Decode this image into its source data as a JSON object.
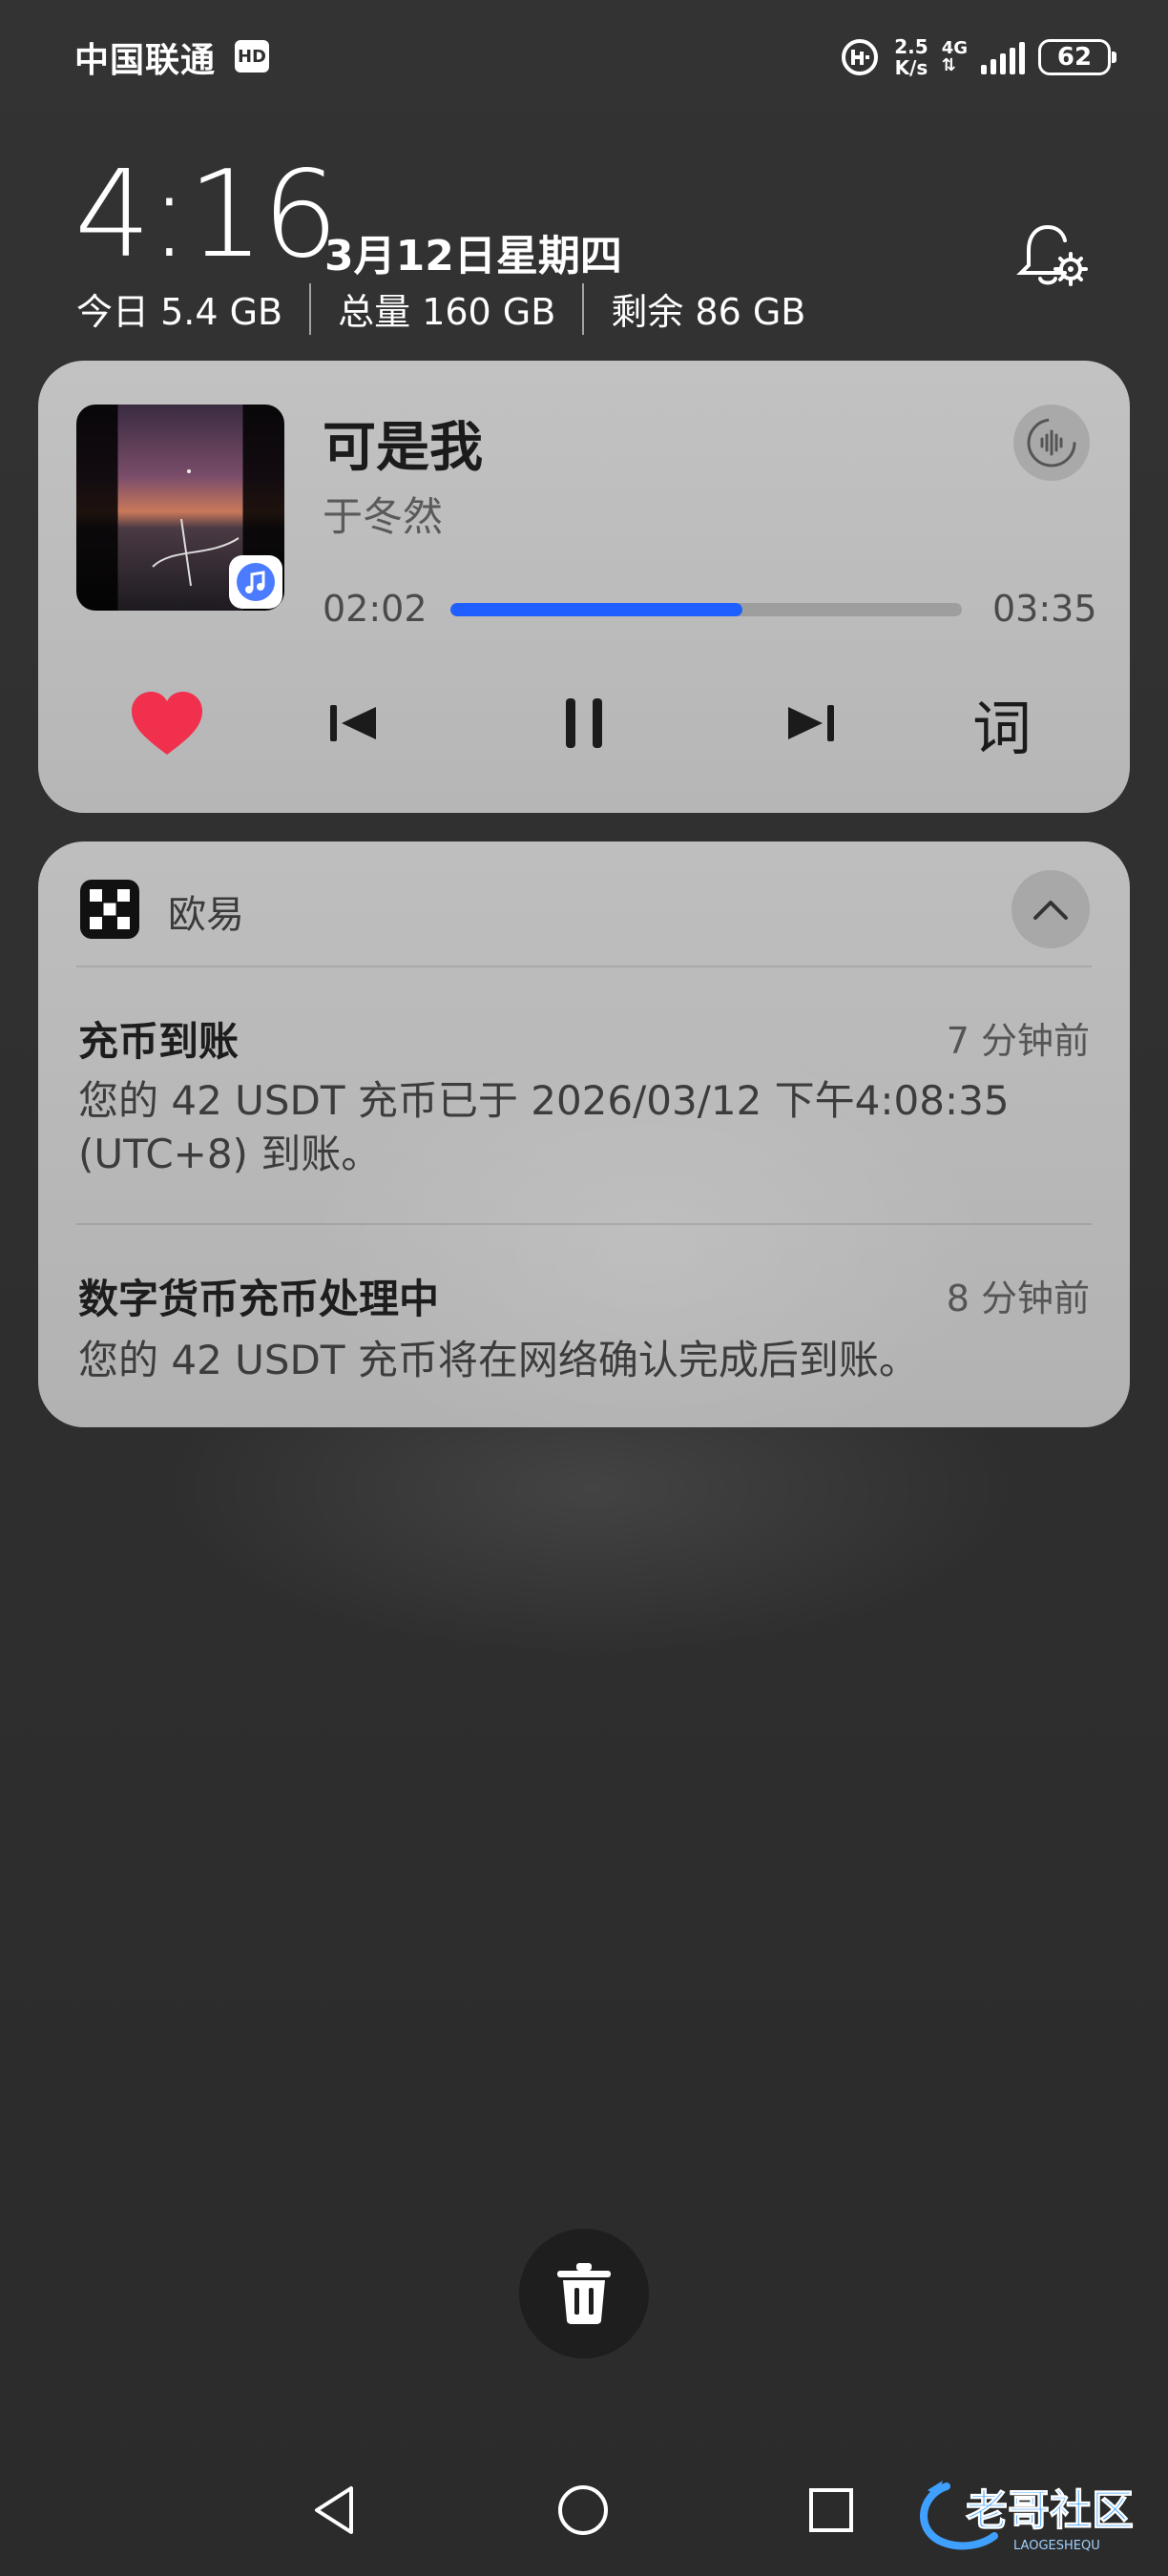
{
  "status_bar": {
    "carrier": "中国联通",
    "hd_badge": "HD",
    "speed_value": "2.5",
    "speed_unit": "K/s",
    "network": "4G",
    "battery": "62"
  },
  "header": {
    "time": "4:16",
    "date": "3月12日星期四",
    "today_usage": "今日 5.4 GB",
    "total": "总量 160 GB",
    "remaining": "剩余 86 GB"
  },
  "music": {
    "title": "可是我",
    "artist": "于冬然",
    "current_time": "02:02",
    "total_time": "03:35",
    "progress": 0.57,
    "lyric_label": "词"
  },
  "notification_group": {
    "app_name": "欧易",
    "items": [
      {
        "title": "充币到账",
        "time": "7 分钟前",
        "body": "您的 42 USDT 充币已于 2026/03/12 下午4:08:35 (UTC+8) 到账。"
      },
      {
        "title": "数字货币充币处理中",
        "time": "8 分钟前",
        "body": "您的 42 USDT 充币将在网络确认完成后到账。"
      }
    ]
  },
  "watermark": {
    "text": "老哥社区",
    "subtext": "LAOGESHEQU"
  },
  "colors": {
    "accent_blue": "#1f5fff",
    "heart_red": "#f0304c"
  }
}
